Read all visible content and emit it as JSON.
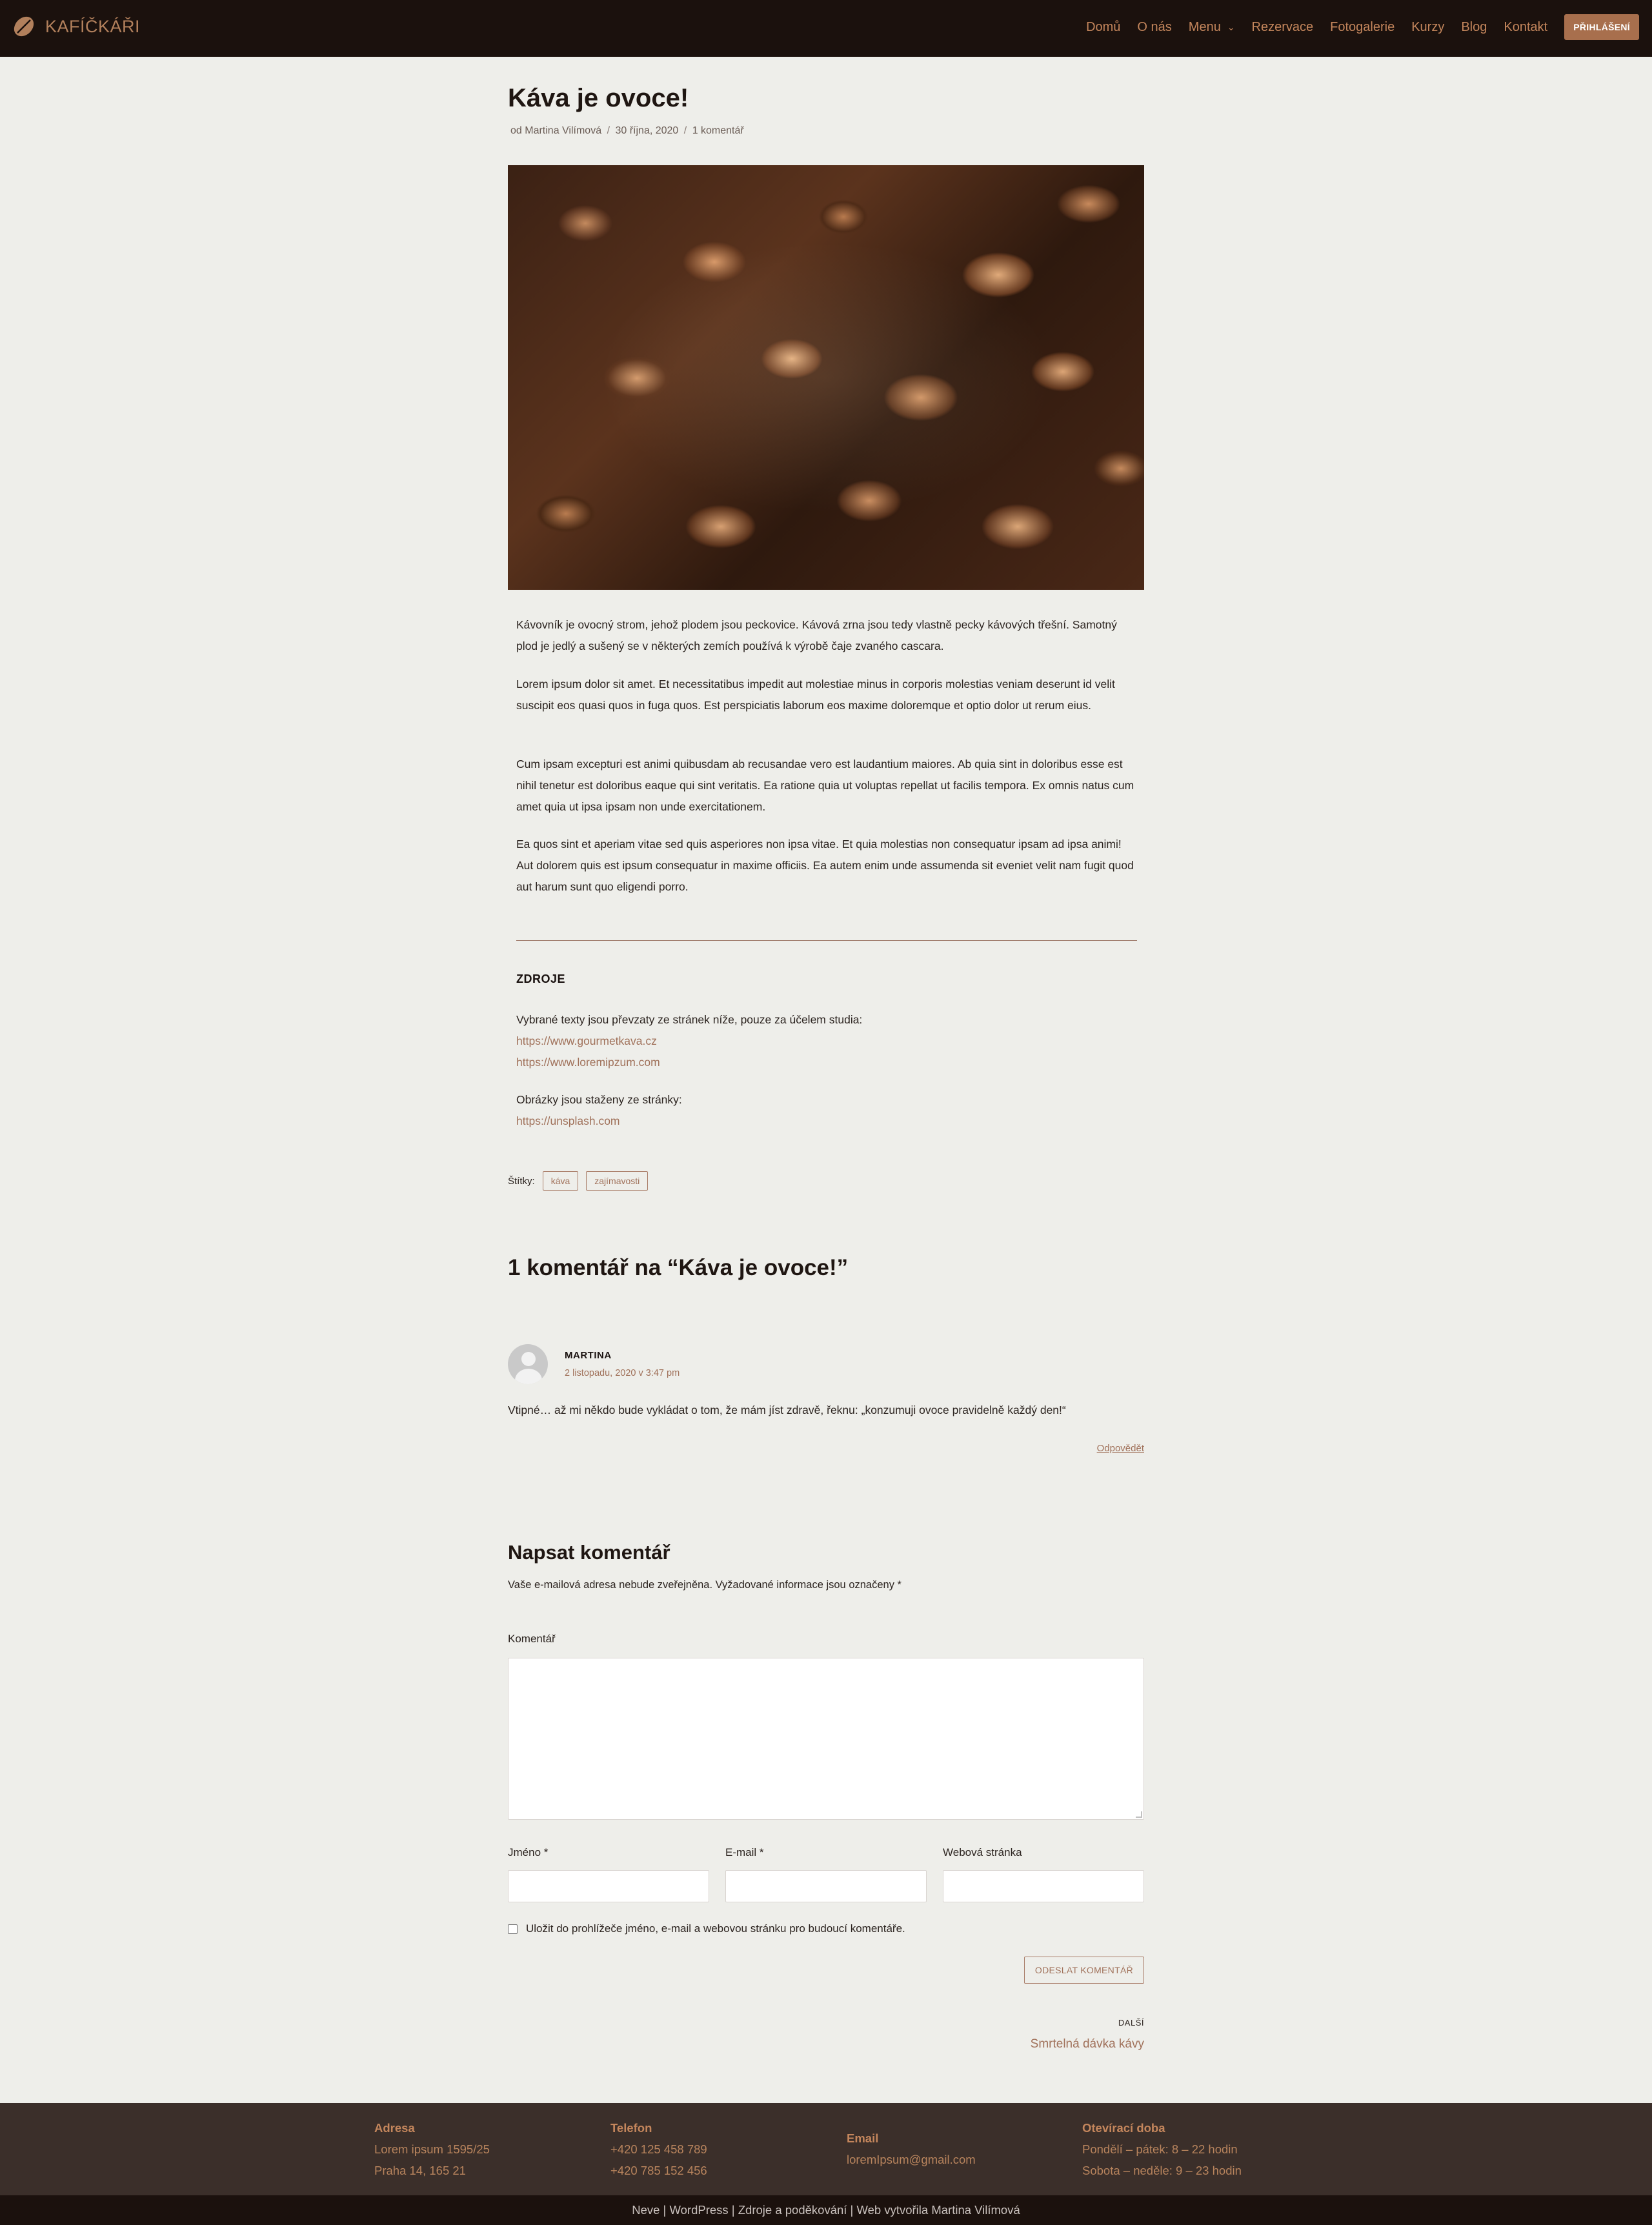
{
  "header": {
    "brand": "KAFÍČKÁŘI",
    "nav": [
      "Domů",
      "O nás",
      "Menu",
      "Rezervace",
      "Fotogalerie",
      "Kurzy",
      "Blog",
      "Kontakt"
    ],
    "login_label": "PŘIHLÁŠENÍ",
    "accent_color": "#b2805c",
    "header_bg": "#1b110d"
  },
  "post": {
    "title": "Káva je ovoce!",
    "meta": {
      "author": "od Martina Vilímová",
      "date": "30 října, 2020",
      "comments": "1 komentář"
    },
    "paragraphs": [
      "Kávovník je ovocný strom, jehož plodem jsou peckovice. Kávová zrna jsou tedy vlastně pecky kávových třešní. Samotný plod je jedlý a sušený se v některých zemích používá k výrobě čaje zvaného cascara.",
      "Lorem ipsum dolor sit amet. Et necessitatibus impedit aut molestiae minus in corporis molestias veniam deserunt id velit suscipit eos quasi quos in fuga quos. Est perspiciatis laborum eos maxime doloremque et optio dolor ut rerum eius.",
      "Cum ipsam excepturi est animi quibusdam ab recusandae vero est laudantium maiores. Ab quia sint in doloribus esse est nihil tenetur est doloribus eaque qui sint veritatis. Ea ratione quia ut voluptas repellat ut facilis tempora. Ex omnis natus cum amet quia ut ipsa ipsam non unde exercitationem.",
      "Ea quos sint et aperiam vitae sed quis asperiores non ipsa vitae. Et quia molestias non consequatur ipsam ad ipsa animi! Aut dolorem quis est ipsum consequatur in maxime officiis. Ea autem enim unde assumenda sit eveniet velit nam fugit quod aut harum sunt quo eligendi porro."
    ],
    "sources": {
      "heading": "ZDROJE",
      "texts_intro": "Vybrané texty jsou převzaty ze stránek níže, pouze za účelem studia:",
      "text_links": [
        "https://www.gourmetkava.cz",
        "https://www.loremipzum.com"
      ],
      "images_intro": "Obrázky jsou staženy ze stránky:",
      "image_link": "https://unsplash.com"
    },
    "tags_label": "Štítky:",
    "tags": [
      "káva",
      "zajímavosti"
    ]
  },
  "comments": {
    "title": "1 komentář na “Káva je ovoce!”",
    "items": [
      {
        "author": "MARTINA",
        "date": "2 listopadu, 2020 v 3:47 pm",
        "text": "Vtipné… až mi někdo bude vykládat o tom, že mám jíst zdravě, řeknu: „konzumuji ovoce pravidelně každý den!“",
        "reply": "Odpovědět"
      }
    ]
  },
  "form": {
    "title": "Napsat komentář",
    "note": "Vaše e-mailová adresa nebude zveřejněna. Vyžadované informace jsou označeny *",
    "comment_label": "Komentář",
    "name_label": "Jméno *",
    "email_label": "E-mail *",
    "web_label": "Webová stránka",
    "save_label": "Uložit do prohlížeče jméno, e-mail a webovou stránku pro budoucí komentáře.",
    "submit_label": "ODESLAT KOMENTÁŘ",
    "comment_value": "",
    "name_value": "",
    "email_value": "",
    "web_value": ""
  },
  "next": {
    "label": "DALŠÍ",
    "title": "Smrtelná dávka kávy"
  },
  "footer": {
    "address": {
      "heading": "Adresa",
      "lines": [
        "Lorem ipsum 1595/25",
        "Praha 14, 165 21"
      ]
    },
    "phone": {
      "heading": "Telefon",
      "lines": [
        "+420 125 458 789",
        "+420 785 152 456"
      ]
    },
    "email": {
      "heading": "Email",
      "lines": [
        "loremIpsum@gmail.com"
      ]
    },
    "hours": {
      "heading": "Otevírací doba",
      "lines": [
        "Pondělí – pátek: 8 – 22 hodin",
        "Sobota – neděle: 9 – 23 hodin"
      ]
    },
    "credits": "Neve | WordPress | Zdroje a poděkování | Web vytvořila Martina Vilímová"
  }
}
